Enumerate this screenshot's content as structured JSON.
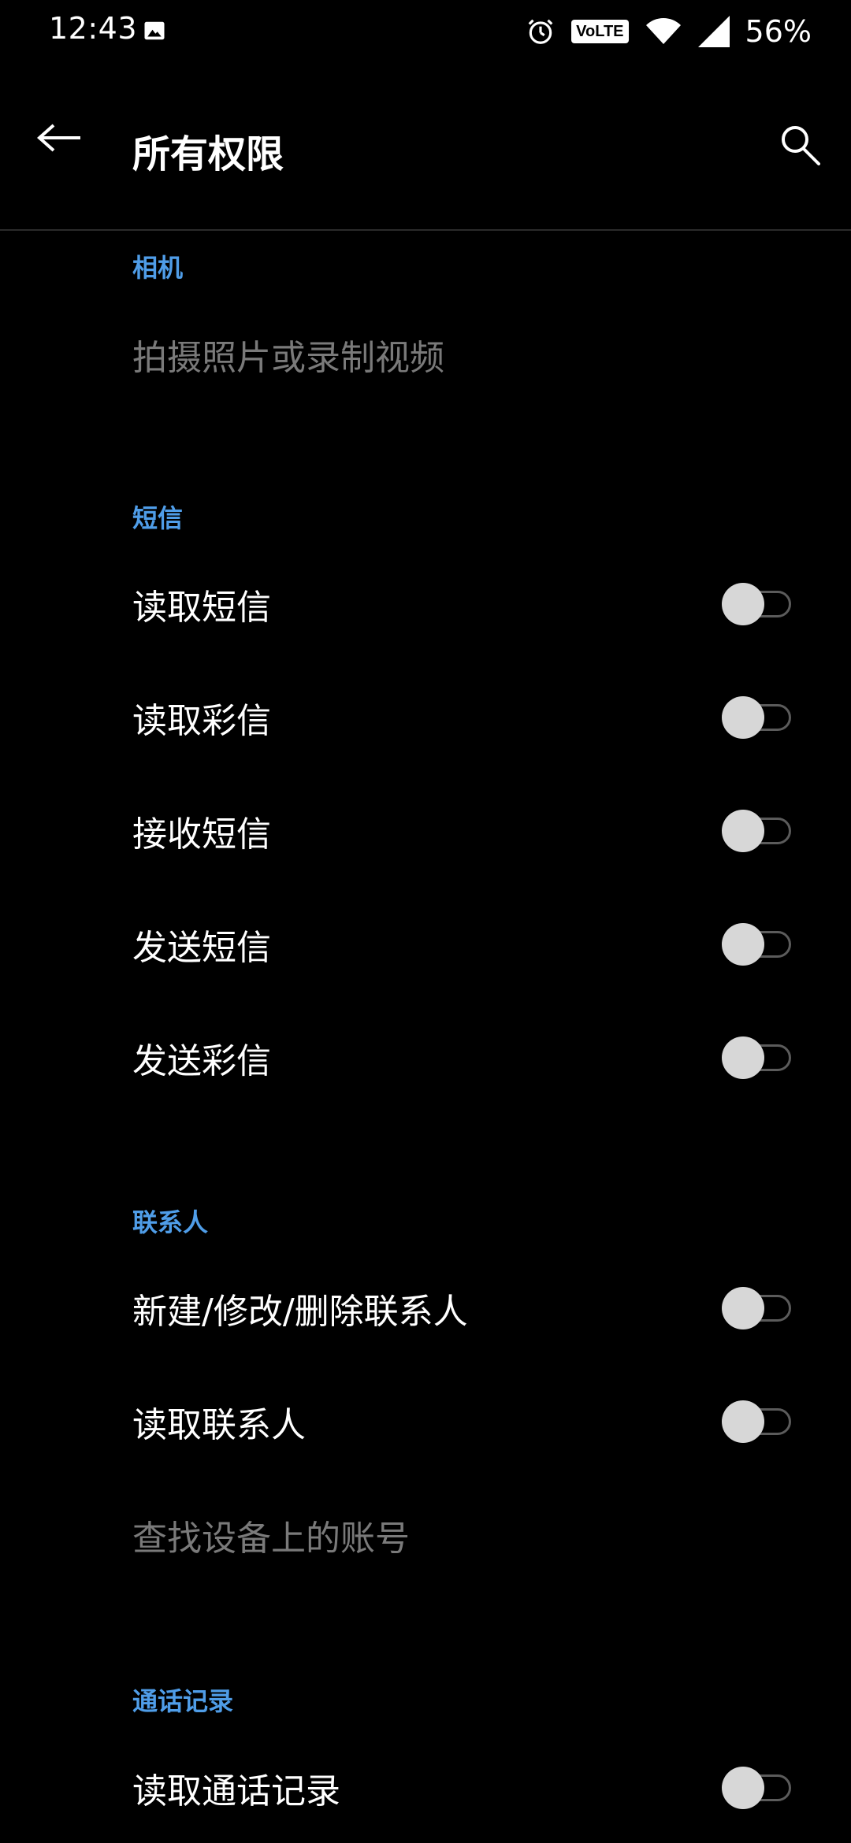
{
  "status_bar": {
    "time": "12:43",
    "network_badge": "VoLTE",
    "battery": "56%",
    "icons": [
      "gallery-icon",
      "alarm-icon",
      "volte-icon",
      "wifi-icon",
      "signal-icon"
    ]
  },
  "app_bar": {
    "title": "所有权限",
    "back_icon": "arrow-left-icon",
    "search_icon": "search-icon"
  },
  "sections": {
    "camera": {
      "header": "相机",
      "items": [
        {
          "label": "拍摄照片或录制视频",
          "enabled": false,
          "has_toggle": false
        }
      ]
    },
    "sms": {
      "header": "短信",
      "items": [
        {
          "label": "读取短信",
          "checked": false
        },
        {
          "label": "读取彩信",
          "checked": false
        },
        {
          "label": "接收短信",
          "checked": false
        },
        {
          "label": "发送短信",
          "checked": false
        },
        {
          "label": "发送彩信",
          "checked": false
        }
      ]
    },
    "contacts": {
      "header": "联系人",
      "items": [
        {
          "label": "新建/修改/删除联系人",
          "checked": false
        },
        {
          "label": "读取联系人",
          "checked": false
        },
        {
          "label": "查找设备上的账号",
          "enabled": false,
          "has_toggle": false
        }
      ]
    },
    "call_log": {
      "header": "通话记录",
      "items": [
        {
          "label": "读取通话记录",
          "checked": false
        }
      ]
    }
  },
  "colors": {
    "background": "#000000",
    "section_header": "#4f9de8",
    "text_primary": "#ffffff",
    "text_disabled": "#7a7a7a",
    "toggle_thumb_off": "#d7d7d7",
    "toggle_track_off": "#5b5b5b",
    "divider": "#2b2b2b"
  }
}
